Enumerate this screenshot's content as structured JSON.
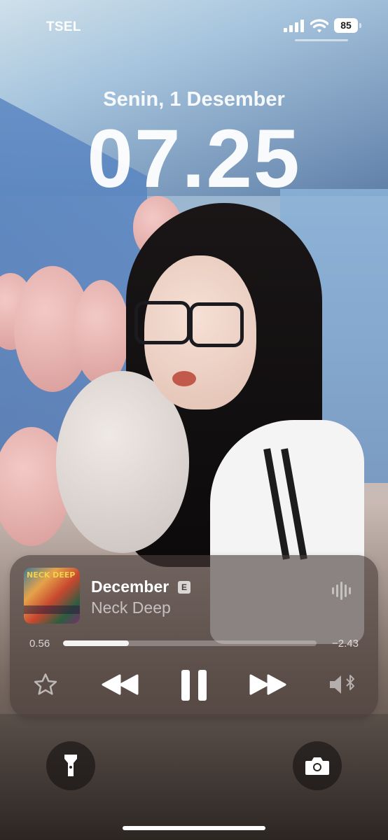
{
  "status_bar": {
    "carrier": "TSEL",
    "battery": "85"
  },
  "lock_screen": {
    "date": "Senin, 1 Desember",
    "time": "07.25"
  },
  "now_playing": {
    "album_art_text": "NECK DEEP",
    "title": "December",
    "explicit_badge": "E",
    "artist": "Neck Deep",
    "elapsed": "0.56",
    "remaining": "−2.43",
    "progress_fraction": 0.26
  },
  "icons": {
    "flashlight": "flashlight-icon",
    "camera": "camera-icon",
    "favorite": "star-icon",
    "rewind": "rewind-icon",
    "pause": "pause-icon",
    "forward": "fast-forward-icon",
    "audio_output": "speaker-bluetooth-icon",
    "waveform": "waveform-icon"
  }
}
